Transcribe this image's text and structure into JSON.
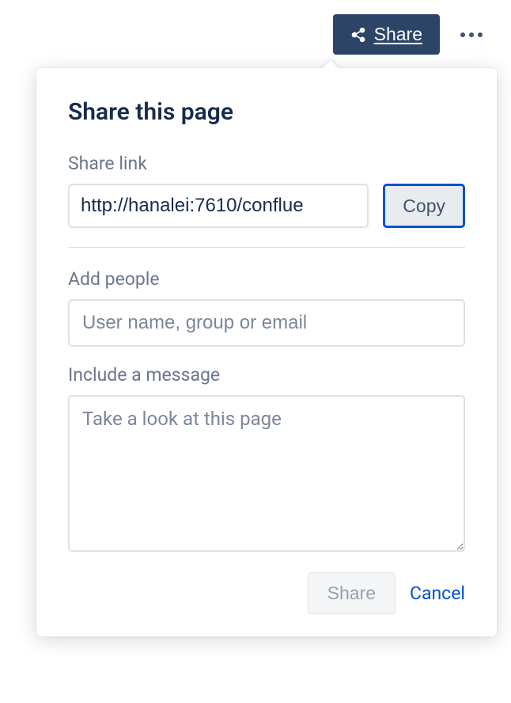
{
  "toolbar": {
    "share_label": "Share"
  },
  "popover": {
    "title": "Share this page",
    "share_link_label": "Share link",
    "link_value": "http://hanalei:7610/conflue",
    "copy_label": "Copy",
    "add_people_label": "Add people",
    "people_placeholder": "User name, group or email",
    "message_label": "Include a message",
    "message_placeholder": "Take a look at this page",
    "submit_label": "Share",
    "cancel_label": "Cancel"
  }
}
